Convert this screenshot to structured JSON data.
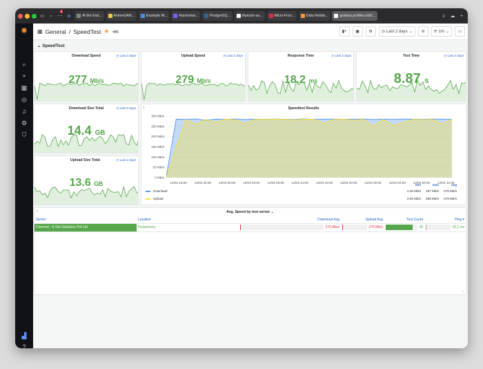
{
  "browser": {
    "tabs": [
      {
        "label": "At the End...",
        "color": "#888888"
      },
      {
        "label": "AnimeGAN...",
        "color": "#f2c94c"
      },
      {
        "label": "Example W...",
        "color": "#4a90e2"
      },
      {
        "label": "Horizontal...",
        "color": "#7b61ff"
      },
      {
        "label": "PostgreSQ...",
        "color": "#336791"
      },
      {
        "label": "titanium-as...",
        "color": "#ffffff"
      },
      {
        "label": "Micro-Fron...",
        "color": "#e02f44"
      },
      {
        "label": "Data Reliab...",
        "color": "#ff9830"
      },
      {
        "label": "grafana.profiles.in/d/...",
        "color": "#ffffff"
      }
    ],
    "notification_count": "8"
  },
  "header": {
    "breadcrumb_folder": "General",
    "separator": "/",
    "dashboard_title": "SpeedTest",
    "time_range": "Last 2 days",
    "refresh": "1m"
  },
  "row_title": "SpeedTest",
  "panels": {
    "download_speed": {
      "title": "Download Speed",
      "range": "Last 2 days",
      "value": "277",
      "unit": "Mb/s"
    },
    "upload_speed": {
      "title": "Upload Speed",
      "range": "Last 2 days",
      "value": "279",
      "unit": "Mb/s"
    },
    "response_time": {
      "title": "Response Time",
      "range": "Last 2 days",
      "value": "18.2",
      "unit": "ms"
    },
    "test_time": {
      "title": "Test Time",
      "range": "Last 2 days",
      "value": "8.87",
      "unit": "s"
    },
    "download_size_total": {
      "title": "Download Size Total",
      "range": "Last 2 days",
      "value": "14.4",
      "unit": "GB"
    },
    "upload_size_total": {
      "title": "Upload Size Total",
      "range": "Last 2 days",
      "value": "13.6",
      "unit": "GB"
    }
  },
  "chart_data": {
    "type": "area",
    "title": "Speedtest Results",
    "y_ticks": [
      "300 Mb/s",
      "250 Mb/s",
      "200 Mb/s",
      "150 Mb/s",
      "100 Mb/s",
      "50 Mb/s",
      "0 Mb/s"
    ],
    "ylim": [
      0,
      300
    ],
    "x_ticks": [
      "12/02 16:00",
      "12/02 20:00",
      "12/03 00:00",
      "12/03 04:00",
      "12/03 08:00",
      "12/03 12:00",
      "12/03 16:00",
      "12/03 20:00",
      "12/04 00:00",
      "12/04 04:00",
      "12/04 08:00",
      "12/04 12:00"
    ],
    "x_start_hours": 14,
    "x_span_hours": 47,
    "series": [
      {
        "name": "Download",
        "color": "#5794f2",
        "min": "4.36 Mb/s",
        "max": "287 Mb/s",
        "avg": "275 Mb/s",
        "values": [
          5,
          285,
          284,
          286,
          280,
          285,
          284,
          286,
          283,
          285,
          284,
          286,
          285,
          283,
          287,
          284,
          285,
          286,
          284,
          285,
          286,
          283,
          285,
          284,
          286,
          285,
          284,
          286,
          285,
          284
        ]
      },
      {
        "name": "Upload",
        "color": "#fade2a",
        "min": "2.05 Mb/s",
        "max": "286 Mb/s",
        "avg": "279 Mb/s",
        "values": [
          2,
          150,
          282,
          260,
          284,
          270,
          285,
          282,
          262,
          284,
          283,
          285,
          284,
          281,
          285,
          284,
          265,
          284,
          284,
          280,
          284,
          250,
          285,
          255,
          268,
          284,
          282,
          284,
          262,
          284
        ]
      }
    ],
    "legend": {
      "headers": [
        "min",
        "max",
        "avg"
      ]
    }
  },
  "table": {
    "title": "Avg. Speed by test server",
    "columns": [
      "Server",
      "Location",
      "Download Avg",
      "Upload Avg",
      "Test Count",
      "Ping"
    ],
    "rows": [
      {
        "server": "Chennet - K Net Solutions Pvt Ltd",
        "location": "Puducherry",
        "download_avg": "275 Mb/s",
        "upload_avg": "279 Mb/s",
        "test_count": "48",
        "ping": "18.2 ms",
        "test_fill_percent": 85
      }
    ]
  },
  "colors": {
    "stat_green": "#56a64b",
    "link_blue": "#1f60c4",
    "accent_red": "#e02f44",
    "star": "#ff9830"
  }
}
